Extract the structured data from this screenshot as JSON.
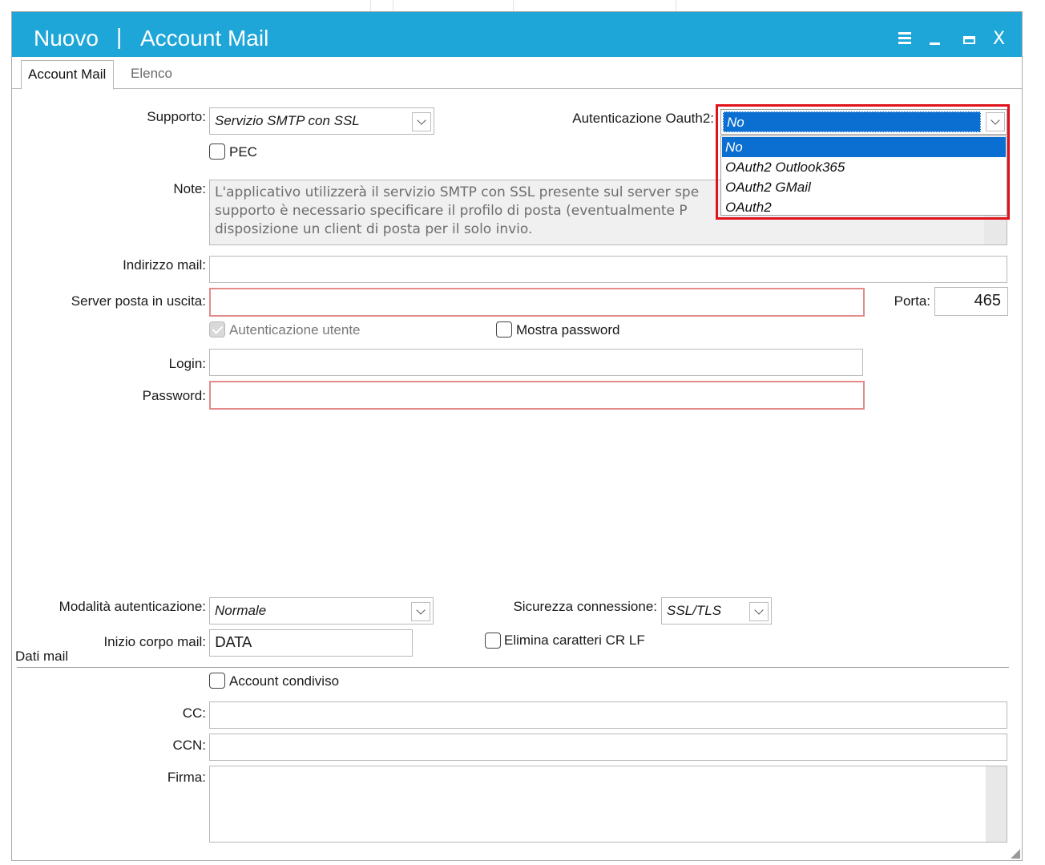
{
  "window": {
    "title_left": "Nuovo",
    "title_separator": "|",
    "title_main": "Account Mail",
    "controls": [
      "menu-icon",
      "minimize-icon",
      "maximize-icon",
      "close-icon"
    ],
    "close_glyph": "X",
    "accent_color": "#1ea6d8"
  },
  "tabs": [
    {
      "label": "Account Mail",
      "active": true
    },
    {
      "label": "Elenco",
      "active": false
    }
  ],
  "form": {
    "supporto_label": "Supporto:",
    "supporto_value": "Servizio SMTP con SSL",
    "oauth_label": "Autenticazione Oauth2:",
    "oauth_value": "No",
    "oauth_options": [
      "No",
      "OAuth2 Outlook365",
      "OAuth2 GMail",
      "OAuth2"
    ],
    "pec_label": "PEC",
    "note_label": "Note:",
    "note_lines": [
      "L'applicativo utilizzerà il servizio SMTP con SSL presente sul server spe",
      "supporto è necessario specificare il profilo di posta (eventualmente P",
      "disposizione un client di posta per il solo invio."
    ],
    "indirizzo_label": "Indirizzo mail:",
    "indirizzo_value": "",
    "server_label": "Server posta in uscita:",
    "server_value": "",
    "porta_label": "Porta:",
    "porta_value": "465",
    "auth_utente_label": "Autenticazione utente",
    "mostra_password_label": "Mostra password",
    "login_label": "Login:",
    "login_value": "",
    "password_label": "Password:",
    "password_value": "",
    "modalita_label": "Modalità autenticazione:",
    "modalita_value": "Normale",
    "sicurezza_label": "Sicurezza connessione:",
    "sicurezza_value": "SSL/TLS",
    "inizio_label": "Inizio corpo mail:",
    "inizio_value": "DATA",
    "elimina_label": "Elimina caratteri CR LF",
    "section_label": "Dati mail",
    "account_condiviso_label": "Account condiviso",
    "cc_label": "CC:",
    "cc_value": "",
    "ccn_label": "CCN:",
    "ccn_value": "",
    "firma_label": "Firma:",
    "firma_value": ""
  },
  "colors": {
    "selection": "#0b6fd1",
    "highlight_box": "#e0121b",
    "required_border": "#e38b8b"
  }
}
